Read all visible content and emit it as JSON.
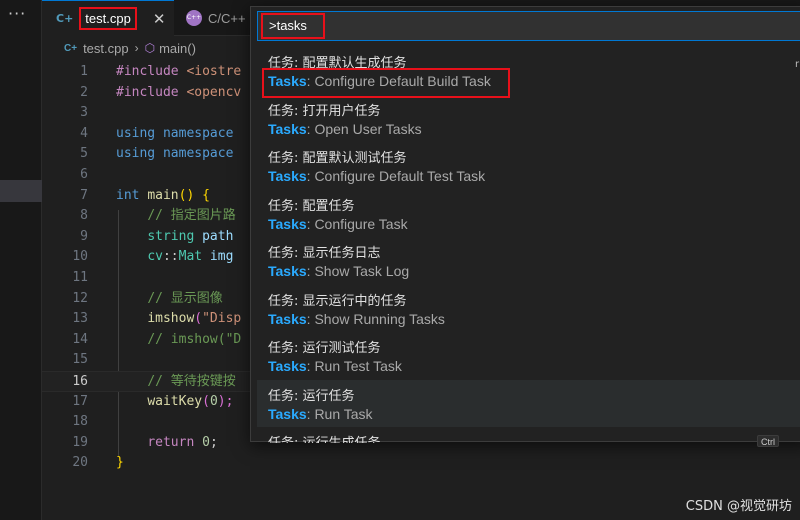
{
  "activity_bar": {
    "more_label": "···"
  },
  "tabs": [
    {
      "label": "test.cpp",
      "icon": "C++",
      "close": "✕"
    },
    {
      "label": "C/C++",
      "icon": "C++"
    }
  ],
  "breadcrumb": {
    "file": "test.cpp",
    "symbol": "main()"
  },
  "editor": {
    "current_line": 16,
    "lines": [
      {
        "n": "1"
      },
      {
        "n": "2"
      },
      {
        "n": "3"
      },
      {
        "n": "4"
      },
      {
        "n": "5"
      },
      {
        "n": "6"
      },
      {
        "n": "7"
      },
      {
        "n": "8"
      },
      {
        "n": "9"
      },
      {
        "n": "10"
      },
      {
        "n": "11"
      },
      {
        "n": "12"
      },
      {
        "n": "13"
      },
      {
        "n": "14"
      },
      {
        "n": "15"
      },
      {
        "n": "16"
      },
      {
        "n": "17"
      },
      {
        "n": "18"
      },
      {
        "n": "19"
      },
      {
        "n": "20"
      }
    ],
    "tokens": {
      "l1_kw": "#include",
      "l1_rest": " <iostre",
      "l2_kw": "#include",
      "l2_rest": " <opencv",
      "l4_a": "using",
      "l4_b": " namespace",
      "l5_a": "using",
      "l5_b": " namespace",
      "l7_a": "int",
      "l7_b": "main",
      "l7_c": "()",
      "l7_d": " {",
      "l8": "// 指定图片路",
      "l9_a": "string",
      "l9_b": " path",
      "l10_a": "cv",
      "l10_b": "::",
      "l10_c": "Mat",
      "l10_d": " img",
      "l12": "// 显示图像",
      "l13_a": "imshow",
      "l13_b": "(",
      "l13_c": "\"Disp",
      "l14": "// imshow(\"D",
      "l16": "// 等待按键按",
      "l17_a": "waitKey",
      "l17_b": "(",
      "l17_c": "0",
      "l17_d": ");",
      "l19_a": "return",
      "l19_b": " 0",
      "l19_c": ";",
      "l20": "}"
    }
  },
  "palette": {
    "query": ">tasks",
    "items": [
      {
        "zh": "任务: 配置默认生成任务",
        "en_prefix": "Tasks",
        "en_rest": ": Configure Default Build Task"
      },
      {
        "zh": "任务: 打开用户任务",
        "en_prefix": "Tasks",
        "en_rest": ": Open User Tasks"
      },
      {
        "zh": "任务: 配置默认测试任务",
        "en_prefix": "Tasks",
        "en_rest": ": Configure Default Test Task"
      },
      {
        "zh": "任务: 配置任务",
        "en_prefix": "Tasks",
        "en_rest": ": Configure Task"
      },
      {
        "zh": "任务: 显示任务日志",
        "en_prefix": "Tasks",
        "en_rest": ": Show Task Log"
      },
      {
        "zh": "任务: 显示运行中的任务",
        "en_prefix": "Tasks",
        "en_rest": ": Show Running Tasks"
      },
      {
        "zh": "任务: 运行测试任务",
        "en_prefix": "Tasks",
        "en_rest": ": Run Test Task"
      },
      {
        "zh": "任务: 运行任务",
        "en_prefix": "Tasks",
        "en_rest": ": Run Task"
      },
      {
        "zh": "任务: 运行生成任务",
        "en_prefix": "",
        "en_rest": ""
      }
    ],
    "keybinding": "Ctrl",
    "side_mark": "r"
  },
  "watermark": "CSDN @视觉研坊",
  "colors": {
    "accent": "#0078d4",
    "annotation_red": "#e8101a",
    "tasks_prefix": "#2aaaff"
  }
}
